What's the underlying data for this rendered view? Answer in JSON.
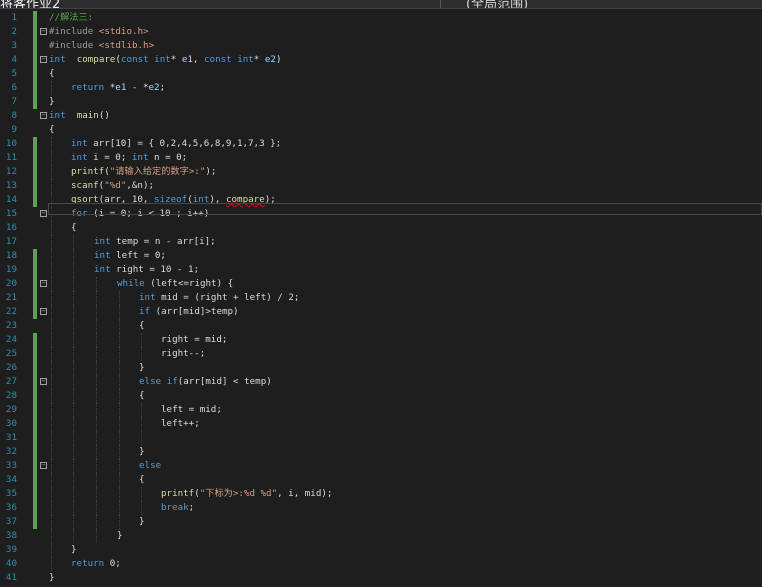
{
  "titlebar": {
    "left_tab": "将客作业2",
    "right_tab": "(全局范围)"
  },
  "lines": [
    {
      "n": "1",
      "c": true,
      "i": 0,
      "t": [
        [
          "cm",
          "//解法三:"
        ]
      ]
    },
    {
      "n": "2",
      "c": true,
      "f": "minus",
      "i": 0,
      "t": [
        [
          "pp",
          "#include "
        ],
        [
          "str",
          "<stdio.h>"
        ]
      ]
    },
    {
      "n": "3",
      "c": true,
      "i": 0,
      "t": [
        [
          "pp",
          "#include "
        ],
        [
          "str",
          "<stdlib.h>"
        ]
      ]
    },
    {
      "n": "4",
      "c": true,
      "f": "minus",
      "i": 0,
      "t": [
        [
          "kw",
          "int"
        ],
        [
          "",
          "  "
        ],
        [
          "fn",
          "compare"
        ],
        [
          "",
          "("
        ],
        [
          "kw",
          "const int"
        ],
        [
          "",
          "* "
        ],
        [
          "par",
          "e1"
        ],
        [
          "",
          ", "
        ],
        [
          "kw",
          "const int"
        ],
        [
          "",
          "* "
        ],
        [
          "par",
          "e2"
        ],
        [
          "",
          ")"
        ]
      ]
    },
    {
      "n": "5",
      "c": true,
      "i": 0,
      "t": [
        [
          "",
          "{"
        ]
      ]
    },
    {
      "n": "6",
      "c": true,
      "i": 1,
      "t": [
        [
          "kw",
          "return"
        ],
        [
          "",
          " *"
        ],
        [
          "par",
          "e1"
        ],
        [
          "",
          " - *"
        ],
        [
          "par",
          "e2"
        ],
        [
          "",
          ";"
        ]
      ]
    },
    {
      "n": "7",
      "c": true,
      "i": 0,
      "t": [
        [
          "",
          "}"
        ]
      ]
    },
    {
      "n": "8",
      "c": false,
      "f": "minus",
      "i": 0,
      "t": [
        [
          "kw",
          "int"
        ],
        [
          "",
          "  "
        ],
        [
          "fn",
          "main"
        ],
        [
          "",
          "()"
        ]
      ]
    },
    {
      "n": "9",
      "c": false,
      "i": 0,
      "t": [
        [
          "",
          "{"
        ]
      ]
    },
    {
      "n": "10",
      "c": true,
      "i": 1,
      "t": [
        [
          "kw",
          "int"
        ],
        [
          "",
          " arr[10] = { 0,2,4,5,6,8,9,1,7,3 };"
        ]
      ]
    },
    {
      "n": "11",
      "c": true,
      "i": 1,
      "t": [
        [
          "kw",
          "int"
        ],
        [
          "",
          " i = 0; "
        ],
        [
          "kw",
          "int"
        ],
        [
          "",
          " n = 0;"
        ]
      ]
    },
    {
      "n": "12",
      "c": true,
      "i": 1,
      "t": [
        [
          "fn",
          "printf"
        ],
        [
          "",
          "("
        ],
        [
          "str",
          "\"请输入给定的数字>:\""
        ],
        [
          "",
          ");"
        ]
      ]
    },
    {
      "n": "13",
      "c": true,
      "i": 1,
      "t": [
        [
          "fn",
          "scanf"
        ],
        [
          "",
          "("
        ],
        [
          "str",
          "\"%d\""
        ],
        [
          "",
          ",&n);"
        ]
      ]
    },
    {
      "n": "14",
      "c": true,
      "cur": true,
      "i": 1,
      "t": [
        [
          "fn",
          "qsort"
        ],
        [
          "",
          "(arr, 10, "
        ],
        [
          "kw",
          "sizeof"
        ],
        [
          "",
          "("
        ],
        [
          "kw",
          "int"
        ],
        [
          "",
          "), "
        ],
        [
          "fn err",
          "compare"
        ],
        [
          "",
          ");"
        ]
      ]
    },
    {
      "n": "15",
      "c": false,
      "f": "minus",
      "i": 1,
      "t": [
        [
          "kw",
          "for"
        ],
        [
          "",
          " (i = 0; i < 10 ; i++)"
        ]
      ]
    },
    {
      "n": "16",
      "c": false,
      "i": 1,
      "t": [
        [
          "",
          "{"
        ]
      ]
    },
    {
      "n": "17",
      "c": false,
      "i": 2,
      "t": [
        [
          "kw",
          "int"
        ],
        [
          "",
          " temp = n - arr[i];"
        ]
      ]
    },
    {
      "n": "18",
      "c": true,
      "i": 2,
      "t": [
        [
          "kw",
          "int"
        ],
        [
          "",
          " left = 0;"
        ]
      ]
    },
    {
      "n": "19",
      "c": true,
      "i": 2,
      "t": [
        [
          "kw",
          "int"
        ],
        [
          "",
          " right = 10 - 1;"
        ]
      ]
    },
    {
      "n": "20",
      "c": true,
      "f": "minus",
      "i": 3,
      "t": [
        [
          "kw",
          "while"
        ],
        [
          "",
          " (left<=right) {"
        ]
      ]
    },
    {
      "n": "21",
      "c": true,
      "i": 4,
      "t": [
        [
          "kw",
          "int"
        ],
        [
          "",
          " mid = (right + left) / 2;"
        ]
      ]
    },
    {
      "n": "22",
      "c": true,
      "f": "minus",
      "i": 4,
      "t": [
        [
          "kw",
          "if"
        ],
        [
          "",
          " (arr[mid]>temp)"
        ]
      ]
    },
    {
      "n": "23",
      "c": false,
      "i": 4,
      "t": [
        [
          "",
          "{"
        ]
      ]
    },
    {
      "n": "24",
      "c": true,
      "i": 5,
      "t": [
        [
          "",
          "right = mid;"
        ]
      ]
    },
    {
      "n": "25",
      "c": true,
      "i": 5,
      "t": [
        [
          "",
          "right--;"
        ]
      ]
    },
    {
      "n": "26",
      "c": true,
      "i": 4,
      "t": [
        [
          "",
          "}"
        ]
      ]
    },
    {
      "n": "27",
      "c": true,
      "f": "minus",
      "i": 4,
      "t": [
        [
          "kw",
          "else if"
        ],
        [
          "",
          "(arr[mid] < temp)"
        ]
      ]
    },
    {
      "n": "28",
      "c": true,
      "i": 4,
      "t": [
        [
          "",
          "{"
        ]
      ]
    },
    {
      "n": "29",
      "c": true,
      "i": 5,
      "t": [
        [
          "",
          "left = mid;"
        ]
      ]
    },
    {
      "n": "30",
      "c": true,
      "i": 5,
      "t": [
        [
          "",
          "left++;"
        ]
      ]
    },
    {
      "n": "31",
      "c": true,
      "i": 5,
      "t": []
    },
    {
      "n": "32",
      "c": true,
      "i": 4,
      "t": [
        [
          "",
          "}"
        ]
      ]
    },
    {
      "n": "33",
      "c": true,
      "f": "minus",
      "i": 4,
      "t": [
        [
          "kw",
          "else"
        ]
      ]
    },
    {
      "n": "34",
      "c": true,
      "i": 4,
      "t": [
        [
          "",
          "{"
        ]
      ]
    },
    {
      "n": "35",
      "c": true,
      "i": 5,
      "t": [
        [
          "fn",
          "printf"
        ],
        [
          "",
          "("
        ],
        [
          "str",
          "\"下标为>:%d %d\""
        ],
        [
          "",
          ", i, mid);"
        ]
      ]
    },
    {
      "n": "36",
      "c": true,
      "i": 5,
      "t": [
        [
          "kw",
          "break"
        ],
        [
          "",
          ";"
        ]
      ]
    },
    {
      "n": "37",
      "c": true,
      "i": 4,
      "t": [
        [
          "",
          "}"
        ]
      ]
    },
    {
      "n": "38",
      "c": false,
      "i": 3,
      "t": [
        [
          "",
          "}"
        ]
      ]
    },
    {
      "n": "39",
      "c": false,
      "i": 1,
      "t": [
        [
          "",
          "}"
        ]
      ]
    },
    {
      "n": "40",
      "c": false,
      "i": 1,
      "t": [
        [
          "kw",
          "return"
        ],
        [
          "",
          " 0;"
        ]
      ]
    },
    {
      "n": "41",
      "c": false,
      "i": 0,
      "t": [
        [
          "",
          "}"
        ]
      ]
    }
  ]
}
